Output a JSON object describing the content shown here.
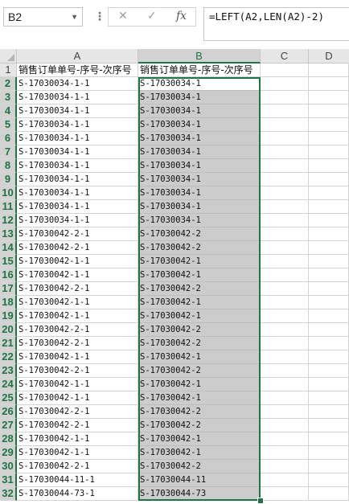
{
  "formula_bar": {
    "name_box": "B2",
    "cancel_icon": "✕",
    "enter_icon": "✓",
    "fx_label": "fx",
    "formula": "=LEFT(A2,LEN(A2)-2)"
  },
  "columns": [
    "A",
    "B",
    "C",
    "D"
  ],
  "header_row": {
    "row_number": "1",
    "a": "销售订单单号-序号-次序号",
    "b": "销售订单单号-序号-次序号"
  },
  "rows": [
    {
      "n": "2",
      "a": "S-17030034-1-1",
      "b": "S-17030034-1"
    },
    {
      "n": "3",
      "a": "S-17030034-1-1",
      "b": "S-17030034-1"
    },
    {
      "n": "4",
      "a": "S-17030034-1-1",
      "b": "S-17030034-1"
    },
    {
      "n": "5",
      "a": "S-17030034-1-1",
      "b": "S-17030034-1"
    },
    {
      "n": "6",
      "a": "S-17030034-1-1",
      "b": "S-17030034-1"
    },
    {
      "n": "7",
      "a": "S-17030034-1-1",
      "b": "S-17030034-1"
    },
    {
      "n": "8",
      "a": "S-17030034-1-1",
      "b": "S-17030034-1"
    },
    {
      "n": "9",
      "a": "S-17030034-1-1",
      "b": "S-17030034-1"
    },
    {
      "n": "10",
      "a": "S-17030034-1-1",
      "b": "S-17030034-1"
    },
    {
      "n": "11",
      "a": "S-17030034-1-1",
      "b": "S-17030034-1"
    },
    {
      "n": "12",
      "a": "S-17030034-1-1",
      "b": "S-17030034-1"
    },
    {
      "n": "13",
      "a": "S-17030042-2-1",
      "b": "S-17030042-2"
    },
    {
      "n": "14",
      "a": "S-17030042-2-1",
      "b": "S-17030042-2"
    },
    {
      "n": "15",
      "a": "S-17030042-1-1",
      "b": "S-17030042-1"
    },
    {
      "n": "16",
      "a": "S-17030042-1-1",
      "b": "S-17030042-1"
    },
    {
      "n": "17",
      "a": "S-17030042-2-1",
      "b": "S-17030042-2"
    },
    {
      "n": "18",
      "a": "S-17030042-1-1",
      "b": "S-17030042-1"
    },
    {
      "n": "19",
      "a": "S-17030042-1-1",
      "b": "S-17030042-1"
    },
    {
      "n": "20",
      "a": "S-17030042-2-1",
      "b": "S-17030042-2"
    },
    {
      "n": "21",
      "a": "S-17030042-2-1",
      "b": "S-17030042-2"
    },
    {
      "n": "22",
      "a": "S-17030042-1-1",
      "b": "S-17030042-1"
    },
    {
      "n": "23",
      "a": "S-17030042-2-1",
      "b": "S-17030042-2"
    },
    {
      "n": "24",
      "a": "S-17030042-1-1",
      "b": "S-17030042-1"
    },
    {
      "n": "25",
      "a": "S-17030042-1-1",
      "b": "S-17030042-1"
    },
    {
      "n": "26",
      "a": "S-17030042-2-1",
      "b": "S-17030042-2"
    },
    {
      "n": "27",
      "a": "S-17030042-2-1",
      "b": "S-17030042-2"
    },
    {
      "n": "28",
      "a": "S-17030042-1-1",
      "b": "S-17030042-1"
    },
    {
      "n": "29",
      "a": "S-17030042-1-1",
      "b": "S-17030042-1"
    },
    {
      "n": "30",
      "a": "S-17030042-2-1",
      "b": "S-17030042-2"
    },
    {
      "n": "31",
      "a": "S-17030044-11-1",
      "b": "S-17030044-11"
    },
    {
      "n": "32",
      "a": "S-17030044-73-1",
      "b": "S-17030044-73"
    }
  ],
  "colors": {
    "selection_accent": "#217346",
    "selection_fill": "#cccccc",
    "header_fill": "#e6e6e6"
  }
}
